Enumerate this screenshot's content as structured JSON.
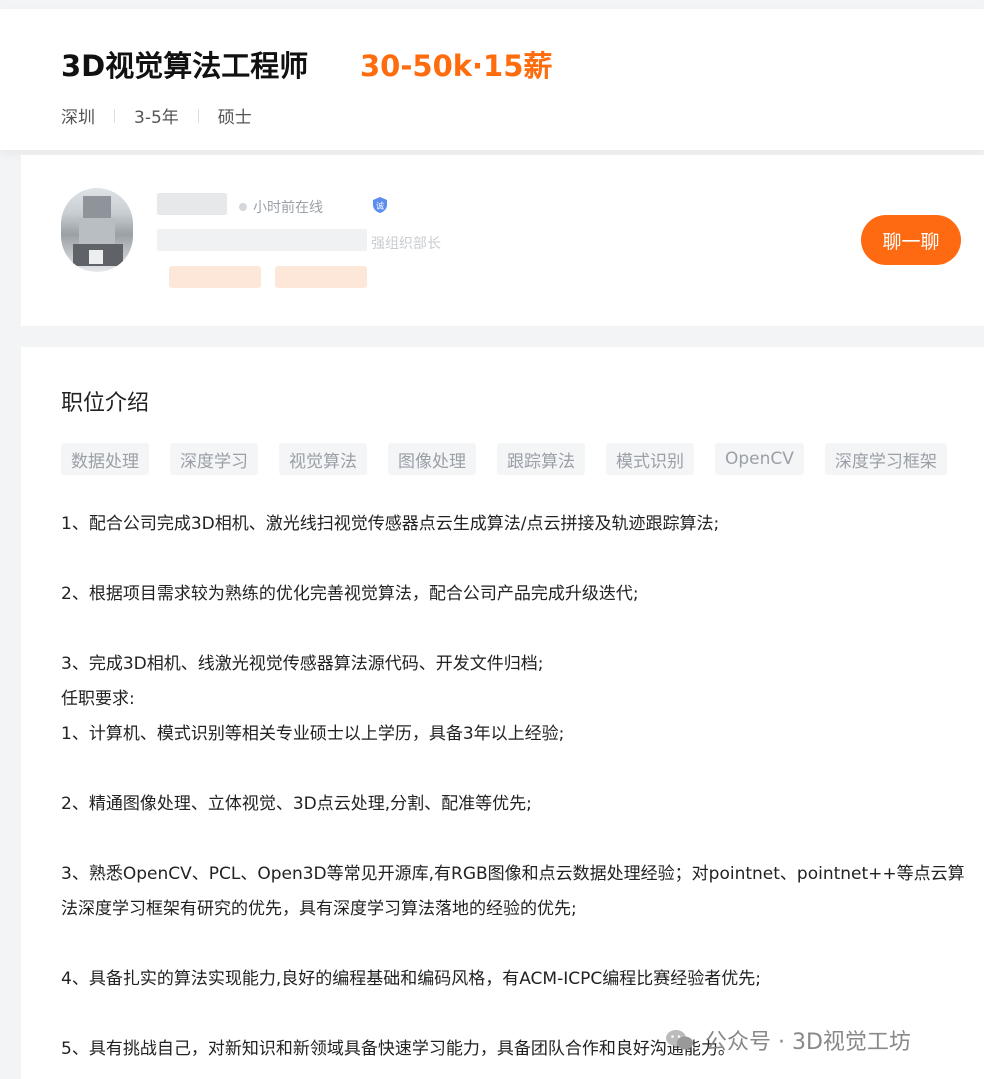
{
  "header": {
    "job_title": "3D视觉算法工程师",
    "salary": "30-50k·15薪",
    "city": "深圳",
    "experience": "3-5年",
    "education": "硕士"
  },
  "recruiter": {
    "online_status": "小时前在线",
    "company_fragment": "强组织部长",
    "chat_button": "聊一聊"
  },
  "description": {
    "title": "职位介绍",
    "tags": [
      "数据处理",
      "深度学习",
      "视觉算法",
      "图像处理",
      "跟踪算法",
      "模式识别",
      "OpenCV",
      "深度学习框架"
    ],
    "lines": [
      "1、配合公司完成3D相机、激光线扫视觉传感器点云生成算法/点云拼接及轨迹跟踪算法;",
      "",
      "2、根据项目需求较为熟练的优化完善视觉算法，配合公司产品完成升级迭代;",
      "",
      "3、完成3D相机、线激光视觉传感器算法源代码、开发文件归档;",
      "任职要求:",
      "1、计算机、模式识别等相关专业硕士以上学历，具备3年以上经验;",
      "",
      "2、精通图像处理、立体视觉、3D点云处理,分割、配准等优先;",
      "",
      "3、熟悉OpenCV、PCL、Open3D等常见开源库,有RGB图像和点云数据处理经验；对pointnet、pointnet++等点云算",
      "法深度学习框架有研究的优先，具有深度学习算法落地的经验的优先;",
      "",
      "4、具备扎实的算法实现能力,良好的编程基础和编码风格，有ACM-ICPC编程比赛经验者优先;",
      "",
      "5、具有挑战自己，对新知识和新领域具备快速学习能力，具备团队合作和良好沟通能力。"
    ]
  },
  "watermark": {
    "text": "公众号 · 3D视觉工坊",
    "icon": "wechat-icon"
  },
  "colors": {
    "accent": "#fe6a11",
    "salary": "#fe6c0e"
  }
}
